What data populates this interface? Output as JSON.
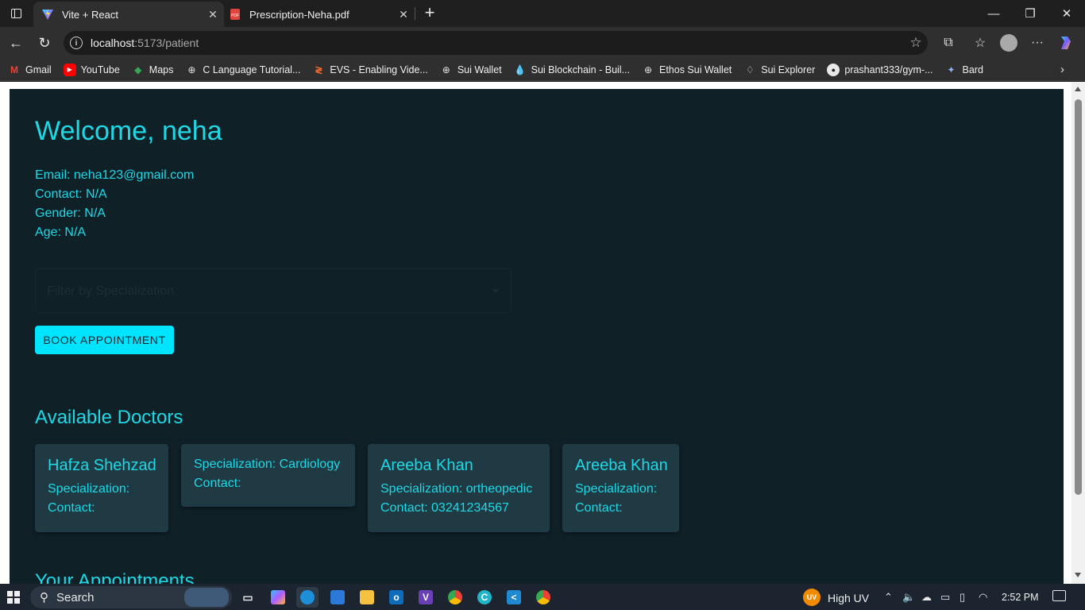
{
  "browser": {
    "tabs": [
      {
        "title": "Vite + React",
        "active": true,
        "favicon": "vite-icon"
      },
      {
        "title": "Prescription-Neha.pdf",
        "active": false,
        "favicon": "pdf-icon"
      }
    ],
    "url_host": "localhost",
    "url_rest": ":5173/patient",
    "bookmarks": [
      {
        "label": "Gmail",
        "icon": "gmail-icon"
      },
      {
        "label": "YouTube",
        "icon": "youtube-icon"
      },
      {
        "label": "Maps",
        "icon": "maps-icon"
      },
      {
        "label": "C Language Tutorial...",
        "icon": "globe-icon"
      },
      {
        "label": "EVS - Enabling Vide...",
        "icon": "evs-icon"
      },
      {
        "label": "Sui Wallet",
        "icon": "globe-icon"
      },
      {
        "label": "Sui Blockchain - Buil...",
        "icon": "sui-drop-icon"
      },
      {
        "label": "Ethos Sui Wallet",
        "icon": "globe-icon"
      },
      {
        "label": "Sui Explorer",
        "icon": "sui-drop-icon"
      },
      {
        "label": "prashant333/gym-...",
        "icon": "github-icon"
      },
      {
        "label": "Bard",
        "icon": "bard-sparkle-icon"
      }
    ]
  },
  "page": {
    "welcome": "Welcome, neha",
    "email": "Email: neha123@gmail.com",
    "contact": "Contact: N/A",
    "gender": "Gender: N/A",
    "age": "Age: N/A",
    "filter_placeholder": "Filter by Specialization",
    "book_button": "BOOK APPOINTMENT",
    "doctors_title": "Available Doctors",
    "appointments_title": "Your Appointments",
    "doctors": [
      {
        "name": "Hafza Shehzad",
        "specialization": "Specialization:",
        "contact": "Contact:"
      },
      {
        "name": "",
        "specialization": "Specialization: Cardiology",
        "contact": "Contact:"
      },
      {
        "name": "Areeba Khan",
        "specialization": "Specialization: ortheopedic",
        "contact": "Contact: 03241234567"
      },
      {
        "name": "Areeba Khan",
        "specialization": "Specialization:",
        "contact": "Contact:"
      }
    ]
  },
  "taskbar": {
    "search_placeholder": "Search",
    "weather_badge": "UV",
    "weather_text": "High UV",
    "time": "2:52 PM"
  },
  "colors": {
    "accent": "#1fd8e6",
    "button": "#00e5ff",
    "page_bg": "#0f2027",
    "card_bg": "#203a43"
  }
}
